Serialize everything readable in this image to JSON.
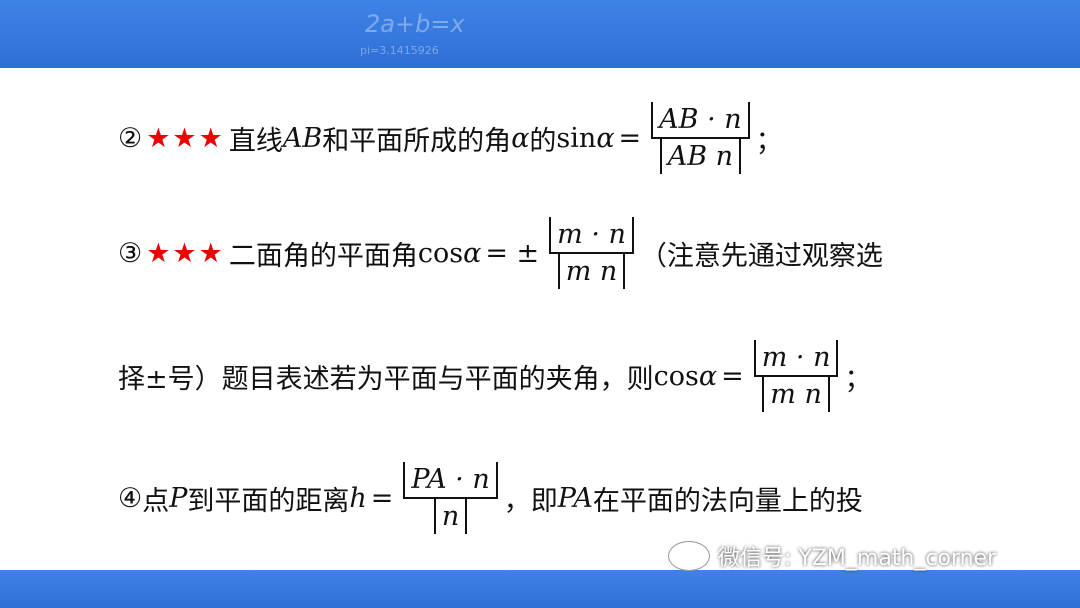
{
  "header": {
    "deco_formula": "2a+b=x",
    "deco_pi": "pi=3.1415926"
  },
  "lines": {
    "l2_marker": "②",
    "l2_stars": "★★★",
    "l2_text_a": "直线",
    "l2_ab": "AB",
    "l2_text_b": "和平面所成的角",
    "l2_alpha": "α",
    "l2_text_c": "的",
    "l2_sin": "sin",
    "l2_eq": "=",
    "l2_num": "AB · n",
    "l2_den": "AB n",
    "l2_end": "；",
    "l3_marker": "③",
    "l3_stars": "★★★",
    "l3_text_a": "二面角的平面角",
    "l3_cos": "cos",
    "l3_alpha": "α",
    "l3_eq": "= ±",
    "l3_num": "m · n",
    "l3_den": "m n",
    "l3_text_b": "（注意先通过观察选",
    "l4_text_a": "择±号）题目表述若为平面与平面的夹角，则",
    "l4_cos": "cos",
    "l4_alpha": "α",
    "l4_eq": "=",
    "l4_num": "m · n",
    "l4_den": "m n",
    "l4_end": "；",
    "l5_marker": "④",
    "l5_text_a": "点",
    "l5_p": "P",
    "l5_text_b": "到平面的距离",
    "l5_h": "h",
    "l5_eq": "=",
    "l5_num": "PA · n",
    "l5_den": "n",
    "l5_text_c": "，即",
    "l5_pa": "PA",
    "l5_text_d": "在平面的法向量上的投"
  },
  "watermark": {
    "text": "微信号: YZM_math_corner"
  }
}
